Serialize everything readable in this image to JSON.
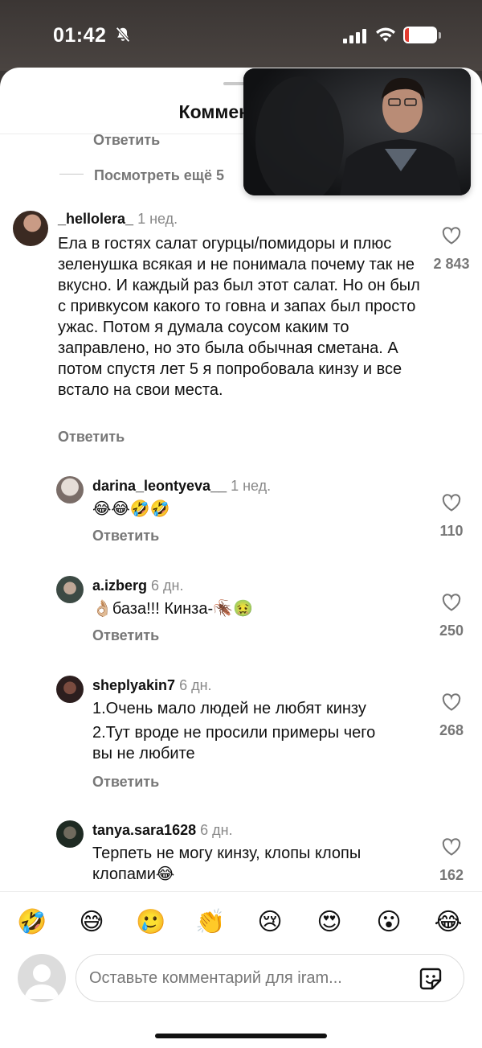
{
  "status": {
    "time": "01:42",
    "battery": "14",
    "battery_level": 0.14
  },
  "sheet": {
    "title": "Комментарии"
  },
  "top": {
    "reply": "Ответить",
    "view_more": "Посмотреть ещё 5"
  },
  "comments": [
    {
      "user": "_hellolera_",
      "time": "1 нед.",
      "text": "Ела в гостях салат огурцы/помидоры и плюс зеленушка всякая и не понимала почему так не вкусно. И каждый раз был этот салат. Но он был с привкусом какого то говна и запах был просто ужас. Потом я думала соусом каким то заправлено, но это была обычная сметана. А потом спустя лет 5 я попробовала кинзу и все встало на свои места.",
      "reply": "Ответить",
      "likes": "2 843"
    },
    {
      "user": "darina_leontyeva__",
      "time": "1 нед.",
      "text": "😂😂🤣🤣",
      "reply": "Ответить",
      "likes": "110"
    },
    {
      "user": "a.izberg",
      "time": "6 дн.",
      "text": "👌🏼база!!! Кинза-🪳🤢",
      "reply": "Ответить",
      "likes": "250"
    },
    {
      "user": "sheplyakin7",
      "time": "6 дн.",
      "text1": "1.Очень мало людей не любят кинзу",
      "text2": "2.Тут вроде не просили примеры чего вы не любите",
      "reply": "Ответить",
      "likes": "268"
    },
    {
      "user": "tanya.sara1628",
      "time": "6 дн.",
      "text": "Терпеть не могу кинзу, клопы клопы клопами😂",
      "likes": "162"
    }
  ],
  "emojis": [
    "🤣",
    "😅",
    "🥲",
    "👏",
    "😢",
    "😍",
    "😮",
    "😂"
  ],
  "input": {
    "placeholder": "Оставьте комментарий для iram..."
  }
}
